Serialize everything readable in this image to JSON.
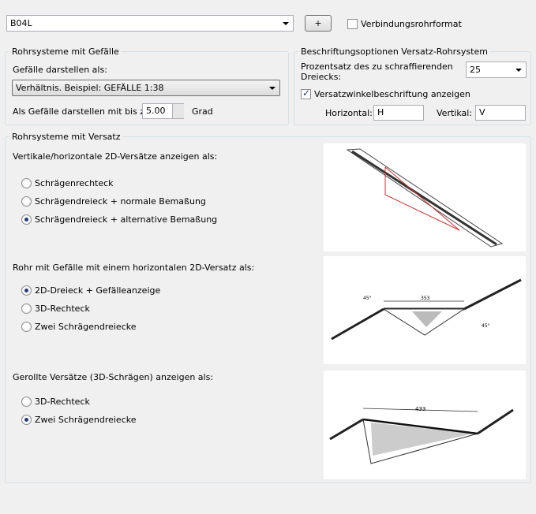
{
  "top": {
    "layer_combo_value": "B04L",
    "add_button_label": "+",
    "connection_format_label": "Verbindungsrohrformat",
    "connection_format_checked": false
  },
  "slope_group": {
    "title": "Rohrsysteme mit Gefälle",
    "display_as_label": "Gefälle darstellen als:",
    "display_as_value": "Verhältnis. Beispiel: GEFÄLLE 1:38",
    "max_label": "Als Gefälle darstellen mit bis zu:",
    "max_value": "5.00",
    "unit": "Grad"
  },
  "label_group": {
    "title": "Beschriftungsoptionen Versatz-Rohrsystem",
    "percent_label_line1": "Prozentsatz des zu schraffierenden",
    "percent_label_line2": "Dreiecks:",
    "percent_value": "25",
    "angle_label": "Versatzwinkelbeschriftung anzeigen",
    "angle_checked": true,
    "horizontal_label": "Horizontal:",
    "horizontal_value": "H",
    "vertical_label": "Vertikal:",
    "vertical_value": "V"
  },
  "offset_group": {
    "title": "Rohrsysteme mit Versatz",
    "section1": {
      "label": "Vertikale/horizontale 2D-Versätze anzeigen als:",
      "options": [
        "Schrägenrechteck",
        "Schrägendreieck + normale Bemaßung",
        "Schrägendreieck + alternative Bemaßung"
      ],
      "selected": 2
    },
    "section2": {
      "label": "Rohr mit Gefälle mit einem horizontalen 2D-Versatz als:",
      "options": [
        "2D-Dreieck + Gefälleanzeige",
        "3D-Rechteck",
        "Zwei Schrägendreiecke"
      ],
      "selected": 0
    },
    "section3": {
      "label": "Gerollte Versätze (3D-Schrägen) anzeigen als:",
      "options": [
        "3D-Rechteck",
        "Zwei Schrägendreiecke"
      ],
      "selected": 1
    }
  },
  "previews": {
    "p2_top_dim": "353",
    "p2_angle_left": "45°",
    "p2_angle_right": "45°",
    "p3_top_dim": "433"
  }
}
